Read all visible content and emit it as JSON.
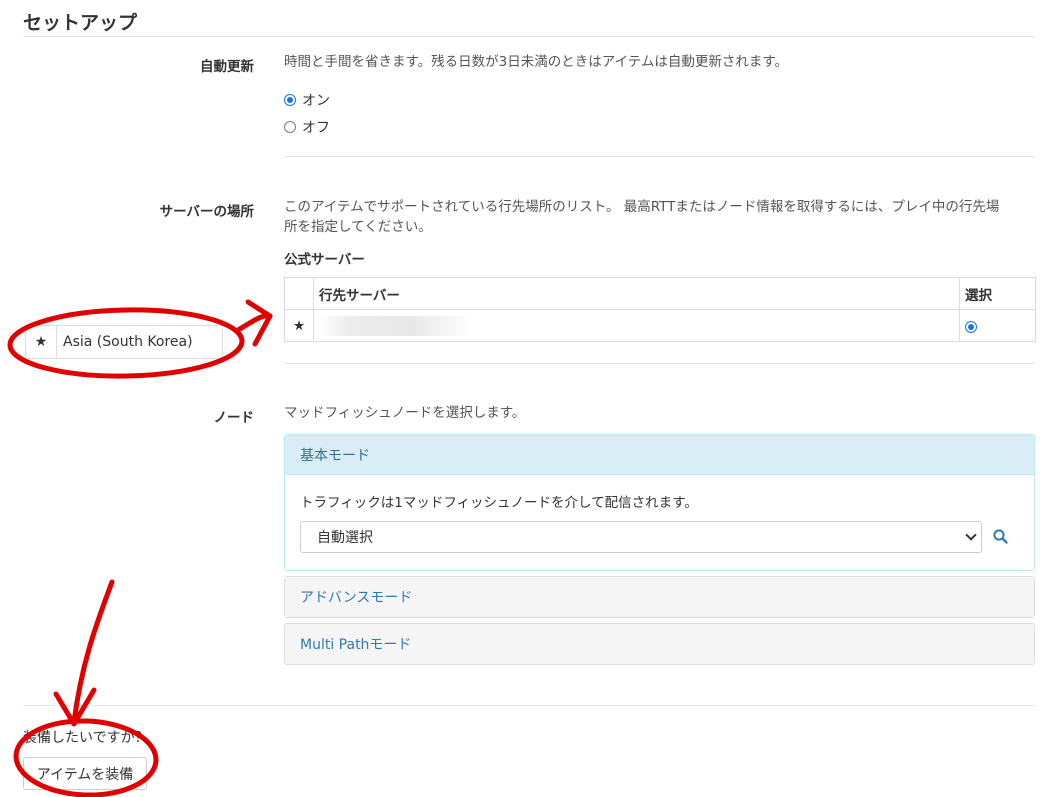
{
  "page": {
    "title": "セットアップ"
  },
  "auto_update": {
    "label": "自動更新",
    "description": "時間と手間を省きます。残る日数が3日未満のときはアイテムは自動更新されます。",
    "options": [
      {
        "label": "オン",
        "selected": true
      },
      {
        "label": "オフ",
        "selected": false
      }
    ]
  },
  "server_location": {
    "label": "サーバーの場所",
    "description_line1": "このアイテムでサポートされている行先場所のリスト。 最高RTTまたはノード情報を取得するには、プレイ中の行先場",
    "description_line2": "所を指定してください。",
    "subheading": "公式サーバー",
    "table": {
      "headers": [
        "",
        "行先サーバー",
        "選択"
      ],
      "rows": [
        {
          "star": "★",
          "server": "",
          "selected": true
        }
      ]
    },
    "callout": {
      "star": "★",
      "text": "Asia (South Korea)"
    }
  },
  "node": {
    "label": "ノード",
    "description": "マッドフィッシュノードを選択します。",
    "panels": [
      {
        "title": "基本モード",
        "active": true,
        "body_text": "トラフィックは1マッドフィッシュノードを介して配信されます。",
        "select_value": "自動選択"
      },
      {
        "title": "アドバンスモード",
        "active": false
      },
      {
        "title": "Multi Pathモード",
        "active": false
      }
    ]
  },
  "equip": {
    "question": "装備したいですか？",
    "button_label": "アイテムを装備"
  },
  "annotation_color": "#e00000",
  "accent_color": "#1a73e8"
}
